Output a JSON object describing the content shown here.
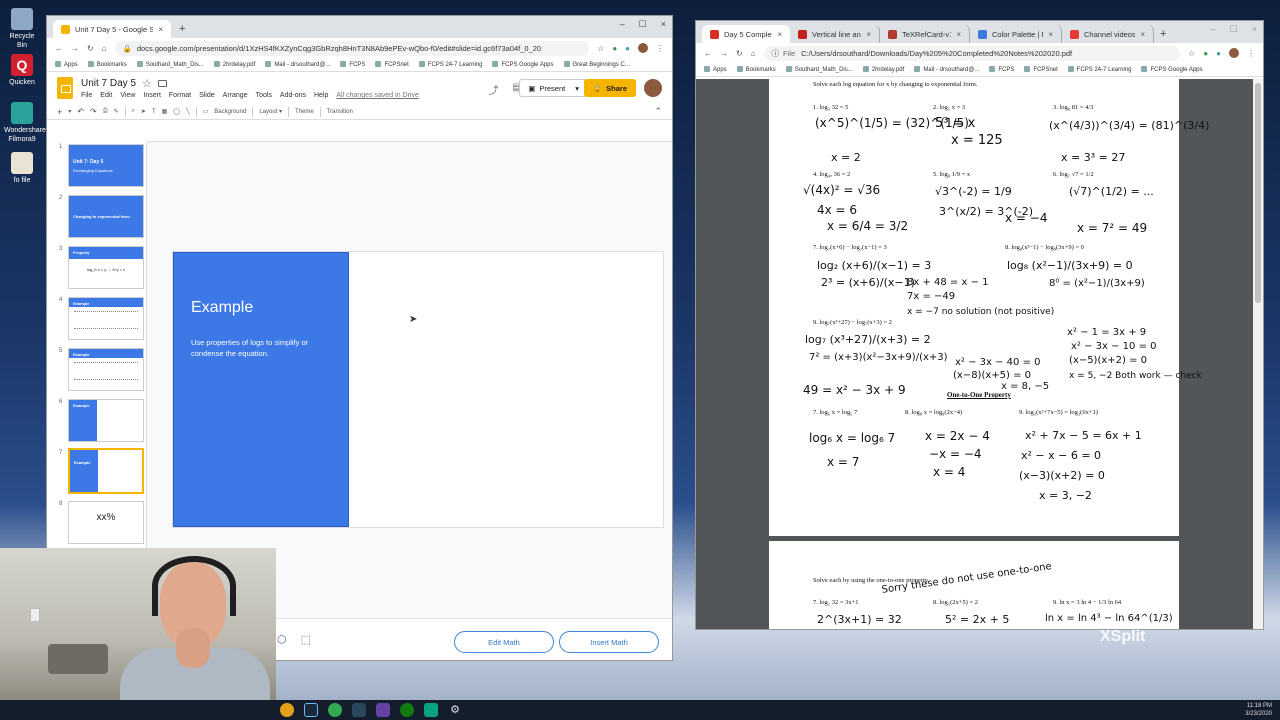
{
  "desktop": {
    "icons": [
      {
        "label": "Recycle Bin",
        "color": "#8fa6c7"
      },
      {
        "label": "Quicken",
        "color": "#d2202f"
      },
      {
        "label": "Wondershare Filmora9",
        "color": "#2aa39a"
      },
      {
        "label": "fo file",
        "color": "#e8e3d2"
      }
    ]
  },
  "slides_window": {
    "tabs": [
      {
        "label": "Unit 7 Day 5 - Google Slides",
        "close": "×"
      }
    ],
    "new_tab": "+",
    "controls": [
      "–",
      "☐",
      "×"
    ],
    "url": "docs.google.com/presentation/d/1XzHS4fKXZynCqg3GbRzqh8HnT3N8Ab9ePEv-wQbo-f0/edit#slide=id.gc6f73a04f_0_20",
    "bookmarks": [
      "Apps",
      "Bookmarks",
      "Southard_Math_Dis...",
      "2hrdelay.pdf",
      "Mail - drsouthard@...",
      "FCPS",
      "FCPSnet",
      "FCPS 24-7 Learning",
      "FCPS Google Apps",
      "Great Beginnings C..."
    ],
    "doc_title": "Unit 7 Day 5",
    "menu": [
      "File",
      "Edit",
      "View",
      "Insert",
      "Format",
      "Slide",
      "Arrange",
      "Tools",
      "Add-ons",
      "Help"
    ],
    "saved_status": "All changes saved in Drive",
    "present_label": "Present",
    "share_label": "Share",
    "toolbar": [
      "Background",
      "Layout ▾",
      "Theme",
      "Transition"
    ],
    "thumbnails": [
      {
        "num": "1",
        "title": "Unit 7: Day 5",
        "sub": "Exchanging Equations"
      },
      {
        "num": "2",
        "title": "Changing to exponential form",
        "sub": ""
      },
      {
        "num": "3",
        "title": "Property",
        "sub": "log_b x = y ⇔ b^y = x"
      },
      {
        "num": "4",
        "title": "Example",
        "sub": ""
      },
      {
        "num": "5",
        "title": "Example",
        "sub": ""
      },
      {
        "num": "6",
        "title": "Example",
        "sub": ""
      },
      {
        "num": "7",
        "title": "Example",
        "sub": ""
      },
      {
        "num": "8",
        "title": "xx%",
        "sub": ""
      },
      {
        "num": "9",
        "title": "",
        "sub": ""
      }
    ],
    "slide": {
      "heading": "Example",
      "body": "Use properties of logs to simplify or condense the equation."
    },
    "edit_math": "Edit Math",
    "insert_math": "Insert Math"
  },
  "pdf_window": {
    "tabs": [
      {
        "label": "Day 5 Completed Not",
        "color": "#d93025"
      },
      {
        "label": "Vertical line and a Fre",
        "color": "#c5221f"
      },
      {
        "label": "TeXRefCard-v1.5.pdf",
        "color": "#b23a2e"
      },
      {
        "label": "Color Palette | Fairfax",
        "color": "#3c7bd8"
      },
      {
        "label": "Channel videos - You",
        "color": "#e53935"
      }
    ],
    "url": "C:/Users/drsouthard/Downloads/Day%205%20Completed%20Notes%202020.pdf",
    "file_label": "File",
    "bookmarks": [
      "Apps",
      "Bookmarks",
      "Southard_Math_Dis...",
      "2hrdelay.pdf",
      "Mail - drsouthard@...",
      "FCPS",
      "FCPSnet",
      "FCPS 24-7 Learning",
      "FCPS Google Apps"
    ],
    "page1_instruction": "Solve each log equation for x by changing to exponential form.",
    "problems": [
      "1. log₃ 32 = 5",
      "2. log₅ x = 3",
      "3. log₈ 81 = 4/3",
      "4. log₄ₓ 36 = 2",
      "5. log₈ 1/9 = x",
      "6. log₇ √7 = 1/2",
      "7. log₂(x+6) − log₂(x−1) = 3",
      "8. log₈(x²−1) − log₈(3x+9) = 0",
      "9. log₇(x³+27) − log₇(x+3) = 2"
    ],
    "section_title": "One-to-One Property",
    "oto_problems": [
      "7. log₆ x = log₆ 7",
      "8. log₈ x = log₈(2x−4)",
      "9. log₃(x²+7x−5) = log₃(6x+1)"
    ],
    "page2_instruction": "Solve each by using the one-to-one property.",
    "page2_problems": [
      "7. log₂ 32 = 3x+1",
      "8. log₅(2x+5) = 2",
      "9. ln x = 3 ln 4 − 1/3 ln 64"
    ],
    "handwriting": {
      "p1": "(x^5)^(1/5) = (32)^(1/5)",
      "p1b": "x = 2",
      "p2": "5³ = x",
      "p2b": "x = 125",
      "p3": "(x^(4/3))^(3/4) = (81)^(3/4)",
      "p3b": "x = 3³ = 27",
      "p4": "√(4x)² = √36",
      "p4b": "4x = 6",
      "p4c": "x = 6/4 = 3/2",
      "p5": "√3^(-2) = 1/9",
      "p5b": "3^(x/2) = 3^(-2)",
      "p5c": "x = −4",
      "p6": "(√7)^(1/2) = ...",
      "p6b": "x = 7² = 49",
      "p7": "log₂ (x+6)/(x−1) = 3",
      "p7b": "2³ = (x+6)/(x−1)",
      "p7c": "8x + 48 = x − 1",
      "p7d": "7x = −49",
      "p7e": "x = −7 no solution (not positive)",
      "p8": "log₈ (x²−1)/(3x+9) = 0",
      "p8b": "8⁰ = (x²−1)/(3x+9)",
      "p8c": "x² − 1 = 3x + 9",
      "p8d": "x² − 3x − 10 = 0",
      "p8e": "(x−5)(x+2) = 0",
      "p8f": "x = 5, −2  Both work — check",
      "p9": "log₇ (x³+27)/(x+3) = 2",
      "p9b": "7² = (x+3)(x²−3x+9)/(x+3)",
      "p9c": "49 = x² − 3x + 9",
      "p9d": "x² − 3x − 40 = 0",
      "p9e": "(x−8)(x+5) = 0",
      "p9f": "x = 8, −5",
      "o7": "log₆ x = log₆ 7",
      "o7b": "x = 7",
      "o8": "x = 2x − 4",
      "o8b": "−x = −4",
      "o8c": "x = 4",
      "o9": "x² + 7x − 5 = 6x + 1",
      "o9b": "x² − x − 6 = 0",
      "o9c": "(x−3)(x+2) = 0",
      "o9d": "x = 3, −2",
      "note": "Sorry these do not use one-to-one",
      "q7": "2^(3x+1) = 32",
      "q8": "5² = 2x + 5",
      "q9": "ln x = ln 4³ − ln 64^(1/3)"
    }
  },
  "overlay": {
    "watermark": "XSplit"
  },
  "tray": {
    "time": "11:18 PM",
    "date": "3/23/2020"
  }
}
